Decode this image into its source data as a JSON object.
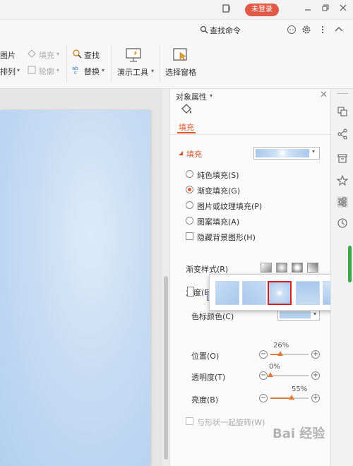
{
  "titlebar": {
    "login_label": "未登录",
    "icons": [
      "tablet-icon",
      "minimize-icon",
      "restore-icon",
      "close-icon"
    ]
  },
  "ribbon": {
    "search_command": "查找命令",
    "picture_label": "图片",
    "arrange_label": "排列",
    "fill_label": "填充",
    "outline_label": "轮廓",
    "find_label": "查找",
    "replace_label": "替换",
    "presentation_tools_label": "演示工具",
    "selection_pane_label": "选择窗格"
  },
  "panel": {
    "title": "对象属性",
    "tab_fill": "填充",
    "section_fill": "填充",
    "options": [
      {
        "label": "纯色填充(S)",
        "selected": false
      },
      {
        "label": "渐变填充(G)",
        "selected": true
      },
      {
        "label": "图片或纹理填充(P)",
        "selected": false
      },
      {
        "label": "图案填充(A)",
        "selected": false
      }
    ],
    "hide_bg_label": "隐藏背景图形(H)",
    "gradient_style_label": "渐变样式(R)",
    "angle_label": "角度(E)",
    "stop_color_label": "色标颜色(C)",
    "position_label": "位置(O)",
    "position_value": "26%",
    "transparency_label": "透明度(T)",
    "transparency_value": "0%",
    "brightness_label": "亮度(B)",
    "brightness_value": "55%",
    "rotate_with_shape_label": "与形状一起旋转(W)",
    "stop_add_symbol": "+",
    "stop_remove_symbol": "✕",
    "minus_symbol": "−",
    "plus_symbol": "+"
  },
  "slider_levels": {
    "position": 0.26,
    "transparency": 0.0,
    "brightness": 0.55
  },
  "watermark": "Bai 经验",
  "colors": {
    "accent": "#e05a2a",
    "login": "#e05a47",
    "selected_outline": "#d91f1f",
    "gradient_blue": "#b8d3f1"
  }
}
